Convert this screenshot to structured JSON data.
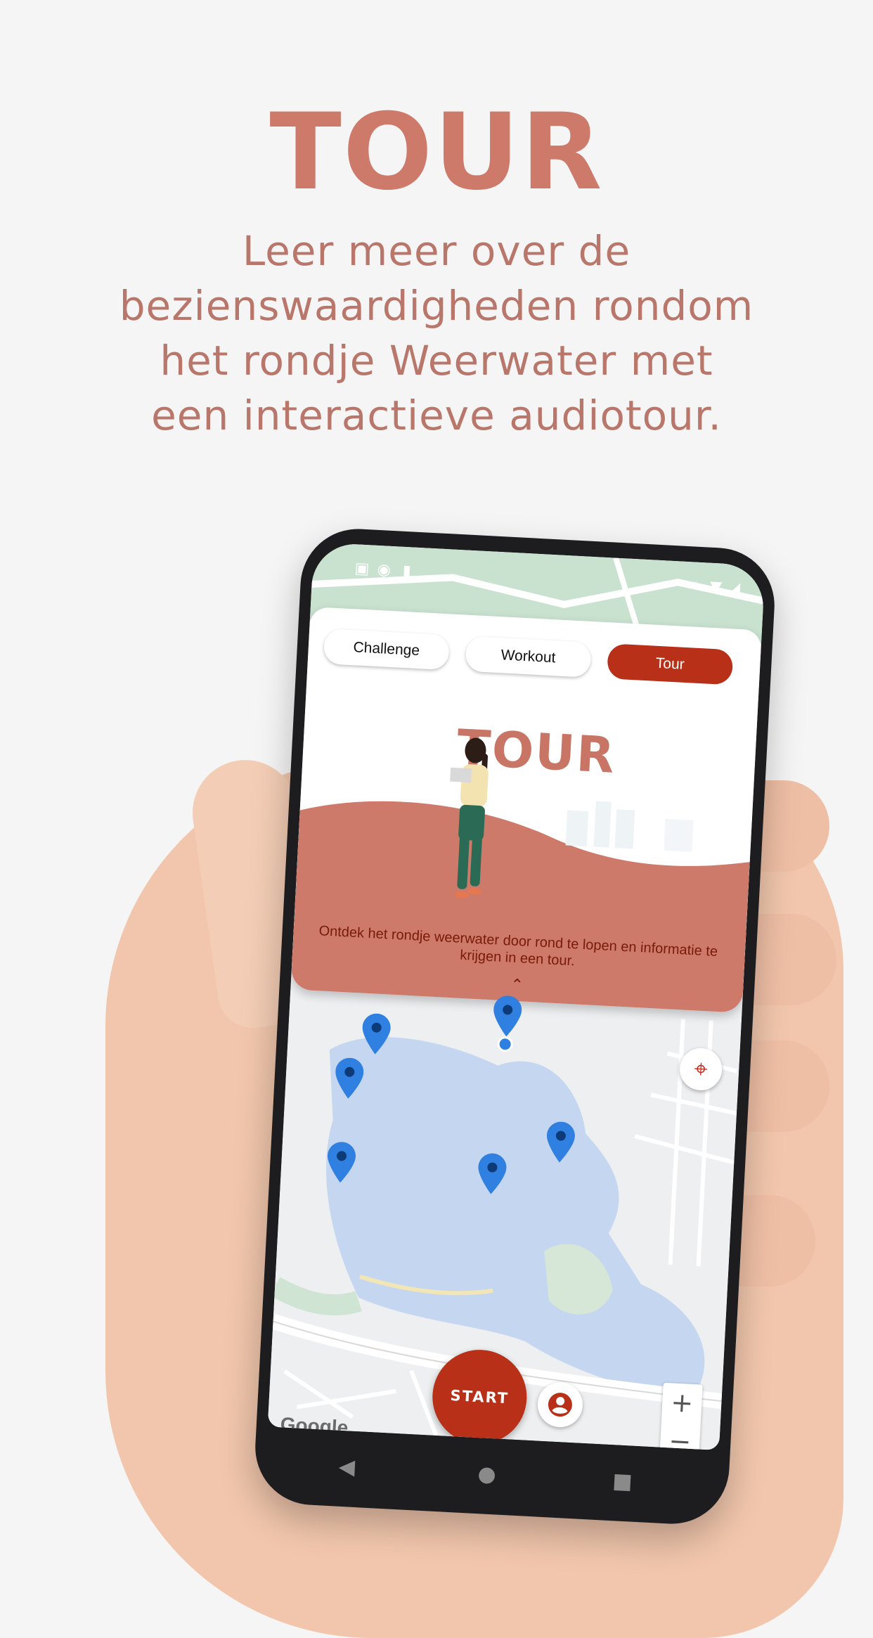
{
  "headline": "TOUR",
  "subtitle_lines": [
    "Leer meer over de",
    "bezienswaardigheden rondom",
    "het rondje Weerwater met",
    "een interactieve audiotour."
  ],
  "app": {
    "tabs": [
      {
        "label": "Challenge",
        "active": false
      },
      {
        "label": "Workout",
        "active": false
      },
      {
        "label": "Tour",
        "active": true
      }
    ],
    "hero_title": "TOUR",
    "hero_description": "Ontdek het rondje weerwater door rond te lopen en informatie te krijgen in een tour.",
    "start_label": "START",
    "map_attribution": "Google",
    "zoom_in": "+",
    "zoom_out": "−"
  },
  "colors": {
    "accent": "#b83018",
    "headline": "#cd7a6a",
    "panel_wave": "#cd7a6a",
    "pin": "#2f80e0"
  }
}
